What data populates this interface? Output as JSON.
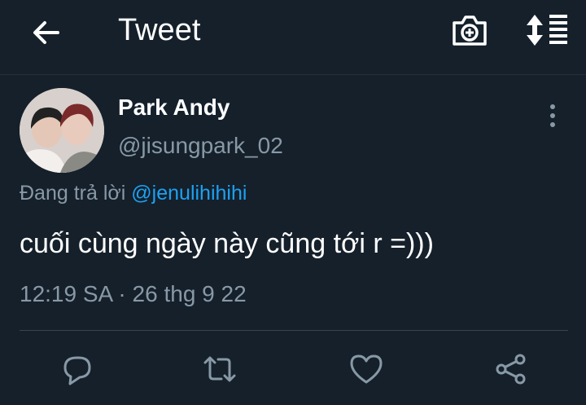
{
  "header": {
    "title": "Tweet",
    "icons": [
      "back-arrow-icon",
      "add-photo-icon",
      "sort-icon"
    ]
  },
  "tweet": {
    "author_name": "Park Andy",
    "author_handle": "@jisungpark_02",
    "reply_prefix": "Đang trả lời",
    "reply_to": "@jenulihihihi",
    "text": "cuối cùng ngày này cũng tới r =)))",
    "timestamp": "12:19 SA · 26 thg 9 22"
  },
  "actions": [
    "reply-icon",
    "retweet-icon",
    "like-icon",
    "share-icon"
  ],
  "colors": {
    "background": "#15202b",
    "accent": "#1da1f2",
    "secondary_text": "#8899a6"
  }
}
